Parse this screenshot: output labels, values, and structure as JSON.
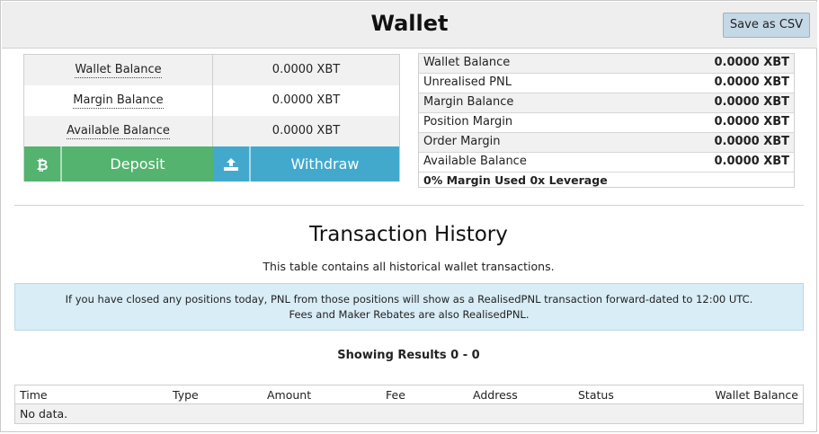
{
  "header": {
    "title": "Wallet",
    "save_csv_label": "Save as CSV"
  },
  "balances": [
    {
      "label": "Wallet Balance",
      "value": "0.0000 XBT"
    },
    {
      "label": "Margin Balance",
      "value": "0.0000 XBT"
    },
    {
      "label": "Available Balance",
      "value": "0.0000 XBT"
    }
  ],
  "actions": {
    "deposit_label": "Deposit",
    "deposit_icon": "bitcoin-icon",
    "withdraw_label": "Withdraw",
    "withdraw_icon": "upload-icon",
    "deposit_color": "#53b36f",
    "withdraw_color": "#42a9cd"
  },
  "summary": {
    "rows": [
      {
        "label": "Wallet Balance",
        "value": "0.0000 XBT"
      },
      {
        "label": "Unrealised PNL",
        "value": "0.0000 XBT"
      },
      {
        "label": "Margin Balance",
        "value": "0.0000 XBT"
      },
      {
        "label": "Position Margin",
        "value": "0.0000 XBT"
      },
      {
        "label": "Order Margin",
        "value": "0.0000 XBT"
      },
      {
        "label": "Available Balance",
        "value": "0.0000 XBT"
      }
    ],
    "footer": "0% Margin Used 0x Leverage"
  },
  "history": {
    "title": "Transaction History",
    "subtitle": "This table contains all historical wallet transactions.",
    "notice_line1": "If you have closed any positions today, PNL from those positions will show as a RealisedPNL transaction forward-dated to 12:00 UTC.",
    "notice_line2": "Fees and Maker Rebates are also RealisedPNL.",
    "showing": "Showing Results 0 - 0",
    "columns": [
      "Time",
      "Type",
      "Amount",
      "Fee",
      "Address",
      "Status",
      "Wallet Balance"
    ],
    "empty_text": "No data."
  }
}
